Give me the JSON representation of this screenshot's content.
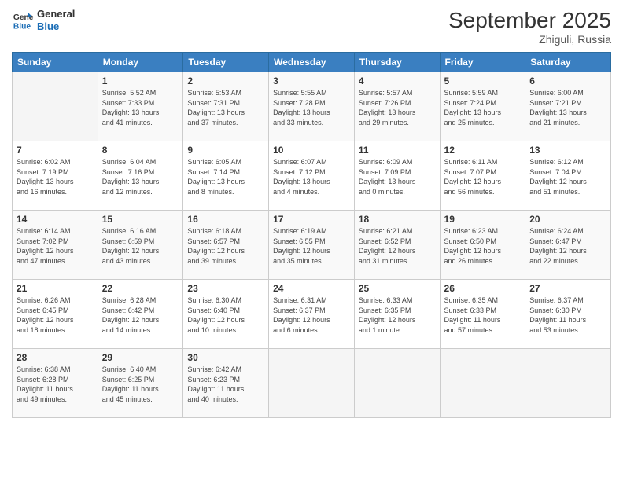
{
  "logo": {
    "line1": "General",
    "line2": "Blue"
  },
  "title": "September 2025",
  "location": "Zhiguli, Russia",
  "days_header": [
    "Sunday",
    "Monday",
    "Tuesday",
    "Wednesday",
    "Thursday",
    "Friday",
    "Saturday"
  ],
  "weeks": [
    [
      {
        "day": "",
        "info": ""
      },
      {
        "day": "1",
        "info": "Sunrise: 5:52 AM\nSunset: 7:33 PM\nDaylight: 13 hours\nand 41 minutes."
      },
      {
        "day": "2",
        "info": "Sunrise: 5:53 AM\nSunset: 7:31 PM\nDaylight: 13 hours\nand 37 minutes."
      },
      {
        "day": "3",
        "info": "Sunrise: 5:55 AM\nSunset: 7:28 PM\nDaylight: 13 hours\nand 33 minutes."
      },
      {
        "day": "4",
        "info": "Sunrise: 5:57 AM\nSunset: 7:26 PM\nDaylight: 13 hours\nand 29 minutes."
      },
      {
        "day": "5",
        "info": "Sunrise: 5:59 AM\nSunset: 7:24 PM\nDaylight: 13 hours\nand 25 minutes."
      },
      {
        "day": "6",
        "info": "Sunrise: 6:00 AM\nSunset: 7:21 PM\nDaylight: 13 hours\nand 21 minutes."
      }
    ],
    [
      {
        "day": "7",
        "info": "Sunrise: 6:02 AM\nSunset: 7:19 PM\nDaylight: 13 hours\nand 16 minutes."
      },
      {
        "day": "8",
        "info": "Sunrise: 6:04 AM\nSunset: 7:16 PM\nDaylight: 13 hours\nand 12 minutes."
      },
      {
        "day": "9",
        "info": "Sunrise: 6:05 AM\nSunset: 7:14 PM\nDaylight: 13 hours\nand 8 minutes."
      },
      {
        "day": "10",
        "info": "Sunrise: 6:07 AM\nSunset: 7:12 PM\nDaylight: 13 hours\nand 4 minutes."
      },
      {
        "day": "11",
        "info": "Sunrise: 6:09 AM\nSunset: 7:09 PM\nDaylight: 13 hours\nand 0 minutes."
      },
      {
        "day": "12",
        "info": "Sunrise: 6:11 AM\nSunset: 7:07 PM\nDaylight: 12 hours\nand 56 minutes."
      },
      {
        "day": "13",
        "info": "Sunrise: 6:12 AM\nSunset: 7:04 PM\nDaylight: 12 hours\nand 51 minutes."
      }
    ],
    [
      {
        "day": "14",
        "info": "Sunrise: 6:14 AM\nSunset: 7:02 PM\nDaylight: 12 hours\nand 47 minutes."
      },
      {
        "day": "15",
        "info": "Sunrise: 6:16 AM\nSunset: 6:59 PM\nDaylight: 12 hours\nand 43 minutes."
      },
      {
        "day": "16",
        "info": "Sunrise: 6:18 AM\nSunset: 6:57 PM\nDaylight: 12 hours\nand 39 minutes."
      },
      {
        "day": "17",
        "info": "Sunrise: 6:19 AM\nSunset: 6:55 PM\nDaylight: 12 hours\nand 35 minutes."
      },
      {
        "day": "18",
        "info": "Sunrise: 6:21 AM\nSunset: 6:52 PM\nDaylight: 12 hours\nand 31 minutes."
      },
      {
        "day": "19",
        "info": "Sunrise: 6:23 AM\nSunset: 6:50 PM\nDaylight: 12 hours\nand 26 minutes."
      },
      {
        "day": "20",
        "info": "Sunrise: 6:24 AM\nSunset: 6:47 PM\nDaylight: 12 hours\nand 22 minutes."
      }
    ],
    [
      {
        "day": "21",
        "info": "Sunrise: 6:26 AM\nSunset: 6:45 PM\nDaylight: 12 hours\nand 18 minutes."
      },
      {
        "day": "22",
        "info": "Sunrise: 6:28 AM\nSunset: 6:42 PM\nDaylight: 12 hours\nand 14 minutes."
      },
      {
        "day": "23",
        "info": "Sunrise: 6:30 AM\nSunset: 6:40 PM\nDaylight: 12 hours\nand 10 minutes."
      },
      {
        "day": "24",
        "info": "Sunrise: 6:31 AM\nSunset: 6:37 PM\nDaylight: 12 hours\nand 6 minutes."
      },
      {
        "day": "25",
        "info": "Sunrise: 6:33 AM\nSunset: 6:35 PM\nDaylight: 12 hours\nand 1 minute."
      },
      {
        "day": "26",
        "info": "Sunrise: 6:35 AM\nSunset: 6:33 PM\nDaylight: 11 hours\nand 57 minutes."
      },
      {
        "day": "27",
        "info": "Sunrise: 6:37 AM\nSunset: 6:30 PM\nDaylight: 11 hours\nand 53 minutes."
      }
    ],
    [
      {
        "day": "28",
        "info": "Sunrise: 6:38 AM\nSunset: 6:28 PM\nDaylight: 11 hours\nand 49 minutes."
      },
      {
        "day": "29",
        "info": "Sunrise: 6:40 AM\nSunset: 6:25 PM\nDaylight: 11 hours\nand 45 minutes."
      },
      {
        "day": "30",
        "info": "Sunrise: 6:42 AM\nSunset: 6:23 PM\nDaylight: 11 hours\nand 40 minutes."
      },
      {
        "day": "",
        "info": ""
      },
      {
        "day": "",
        "info": ""
      },
      {
        "day": "",
        "info": ""
      },
      {
        "day": "",
        "info": ""
      }
    ]
  ]
}
